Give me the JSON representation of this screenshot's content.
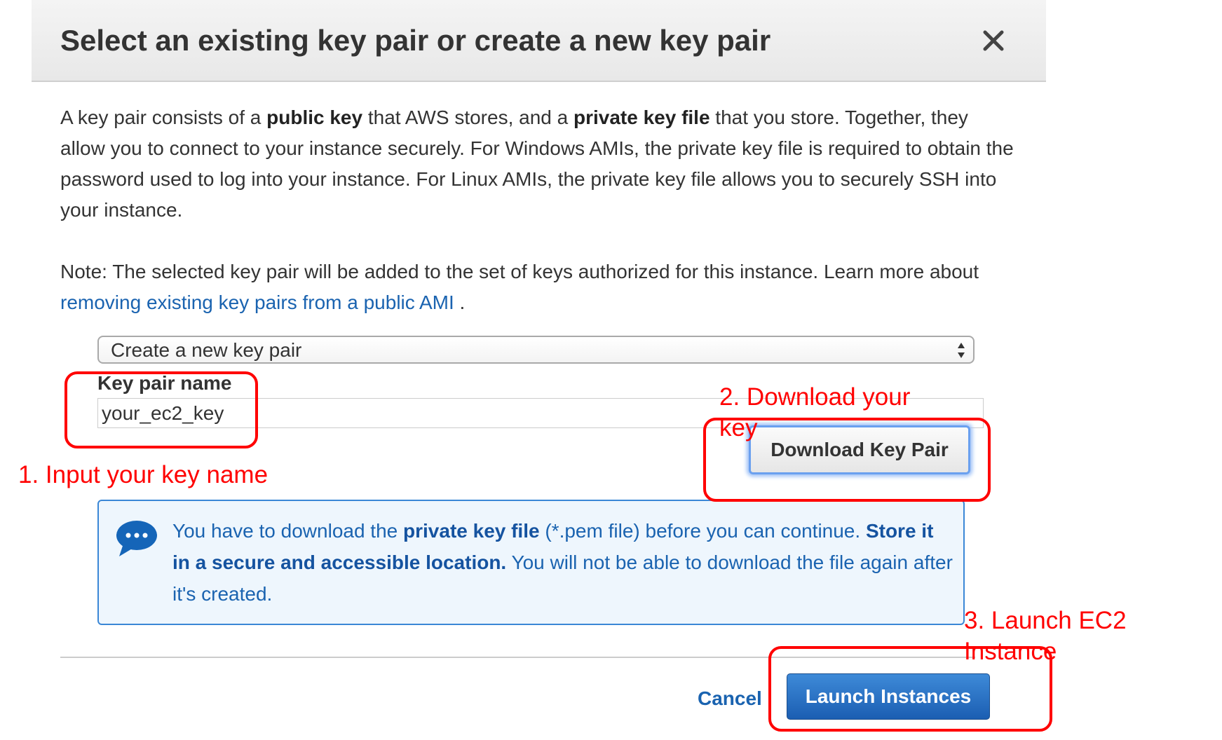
{
  "dialog": {
    "title": "Select an existing key pair or create a new key pair",
    "close_label": "×",
    "intro": {
      "t1": "A key pair consists of a ",
      "b1": "public key",
      "t2": " that AWS stores, and a ",
      "b2": "private key file",
      "t3": " that you store. Together, they allow you to connect to your instance securely. For Windows AMIs, the private key file is required to obtain the password used to log into your instance. For Linux AMIs, the private key file allows you to securely SSH into your instance."
    },
    "note": {
      "text": "Note: The selected key pair will be added to the set of keys authorized for this instance. Learn more about ",
      "link": "removing existing key pairs from a public AMI",
      "end": " ."
    },
    "key_select": {
      "value": "Create a new key pair"
    },
    "key_name": {
      "label": "Key pair name",
      "value": "your_ec2_key"
    },
    "download_button": "Download Key Pair",
    "info": {
      "t1": "You have to download the ",
      "b1": "private key file",
      "t2": " (*.pem file) before you can continue. ",
      "b2": "Store it in a secure and accessible location.",
      "t3": " You will not be able to download the file again after it's created."
    },
    "cancel_label": "Cancel",
    "launch_button": "Launch Instances"
  },
  "annotations": {
    "step1": "1. Input your key name",
    "step2": "2. Download your key",
    "step3": "3. Launch EC2 Instance"
  },
  "colors": {
    "annotation": "#ff0000",
    "link": "#1a63b0",
    "primary_button": "#1b5eb2",
    "info_background": "#eef6fd"
  }
}
